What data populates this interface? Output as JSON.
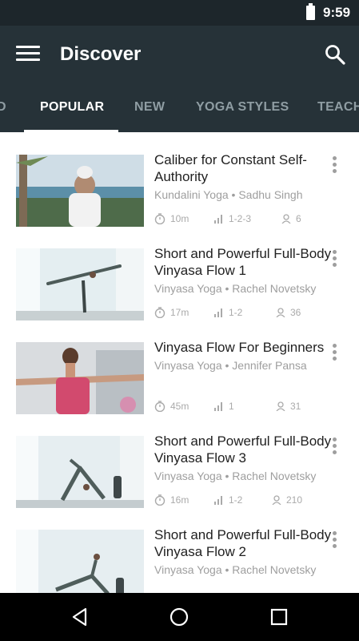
{
  "status_bar": {
    "time": "9:59",
    "battery_icon": "battery-full-icon"
  },
  "app_bar": {
    "title": "Discover",
    "menu_icon": "hamburger-menu-icon",
    "search_icon": "search-icon"
  },
  "tabs": [
    {
      "label": "D"
    },
    {
      "label": "POPULAR",
      "selected": true
    },
    {
      "label": "NEW"
    },
    {
      "label": "YOGA STYLES"
    },
    {
      "label": "TEACH"
    }
  ],
  "videos": [
    {
      "title": "Caliber for Constant Self-Authority",
      "subtitle": "Kundalini Yoga • Sadhu Singh",
      "duration": "10m",
      "level": "1-2-3",
      "students": "6"
    },
    {
      "title": "Short and Powerful Full-Body Vinyasa Flow 1",
      "subtitle": "Vinyasa Yoga • Rachel Novetsky",
      "duration": "17m",
      "level": "1-2",
      "students": "36"
    },
    {
      "title": "Vinyasa Flow For Beginners",
      "subtitle": "Vinyasa Yoga • Jennifer Pansa",
      "duration": "45m",
      "level": "1",
      "students": "31"
    },
    {
      "title": "Short and Powerful Full-Body Vinyasa Flow 3",
      "subtitle": "Vinyasa Yoga • Rachel Novetsky",
      "duration": "16m",
      "level": "1-2",
      "students": "210"
    },
    {
      "title": "Short and Powerful Full-Body Vinyasa Flow 2",
      "subtitle": "Vinyasa Yoga • Rachel Novetsky",
      "duration": "",
      "level": "",
      "students": ""
    }
  ],
  "nav_bar": {
    "back_icon": "back-triangle-icon",
    "home_icon": "home-circle-icon",
    "recents_icon": "recents-square-icon"
  }
}
